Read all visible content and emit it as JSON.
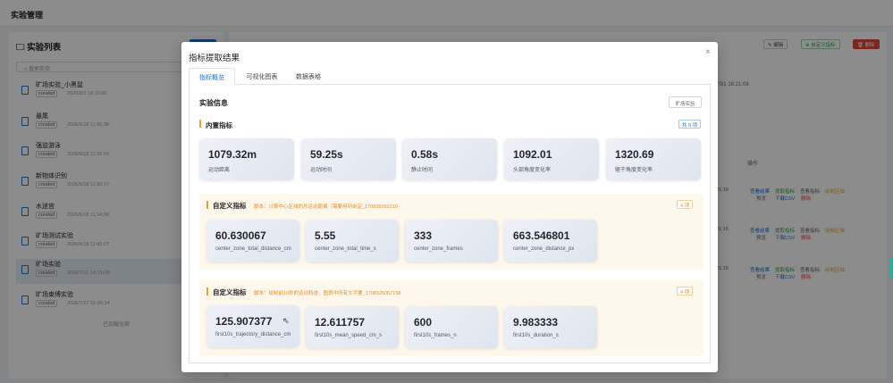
{
  "app": {
    "title": "实验管理",
    "left": {
      "title": "实验列表",
      "search_placeholder": "搜索实验",
      "items": [
        {
          "name": "旷场实验_小黑鼠",
          "status": "created",
          "time": "2026/6/3 18:19:00"
        },
        {
          "name": "悬尾",
          "status": "created",
          "time": "2026/6/18 11:56:38"
        },
        {
          "name": "强迫游泳",
          "status": "created",
          "time": "2026/6/18 11:56:04"
        },
        {
          "name": "新物体识别",
          "status": "created",
          "time": "2026/6/18 11:55:17"
        },
        {
          "name": "水迷宫",
          "status": "created",
          "time": "2026/6/18 11:54:36"
        },
        {
          "name": "旷场测试实验",
          "status": "created",
          "time": "2026/6/18 11:42:07"
        },
        {
          "name": "旷场实验",
          "status": "created",
          "time": "2026/7/31 16:21:08"
        },
        {
          "name": "旷场束缚实验",
          "status": "created",
          "time": "2026/7/27 15:05:34"
        }
      ],
      "footer": "已加载全部"
    },
    "right": {
      "edit": "编辑",
      "custom_metric": "自定义指标",
      "delete": "删除",
      "time": "7/31 16:21:08",
      "ops_header": "操作",
      "row_time": "21:15",
      "ops": {
        "view_result": "查看结果",
        "extract": "提取指标",
        "view_metric": "查看指标",
        "draw_zone": "绘制区域",
        "preview": "预览",
        "download": "下载CSV",
        "del": "删除"
      }
    }
  },
  "modal": {
    "title": "指标提取结果",
    "close": "×",
    "tabs": [
      "指标概览",
      "可视化图表",
      "数据表格"
    ],
    "section_title": "实验信息",
    "section_button": "旷场实验",
    "builtin": {
      "title": "内置指标",
      "count": "共 5 项",
      "cards": [
        {
          "value": "1079.32m",
          "label": "运动距离"
        },
        {
          "value": "59.25s",
          "label": "运动时间"
        },
        {
          "value": "0.58s",
          "label": "静止时间"
        },
        {
          "value": "1092.01",
          "label": "头部角度变化率"
        },
        {
          "value": "1320.69",
          "label": "躯干角度变化率"
        }
      ]
    },
    "custom": [
      {
        "title": "自定义指标",
        "script": "脚本：计算中心区域的总运动距离（需要用到自定_170835059310",
        "count": "4 项",
        "cards": [
          {
            "value": "60.630067",
            "label": "center_zone_total_distance_cm"
          },
          {
            "value": "5.55",
            "label": "center_zone_total_time_s"
          },
          {
            "value": "333",
            "label": "center_zone_frames"
          },
          {
            "value": "663.546801",
            "label": "center_zone_distance_px"
          }
        ]
      },
      {
        "title": "自定义指标",
        "script": "脚本：绘制前10秒的运动轨迹，图表中所有文字要_1708925057158",
        "count": "4 项",
        "cards": [
          {
            "value": "125.907377",
            "label": "first10s_trajectory_distance_cm"
          },
          {
            "value": "12.611757",
            "label": "first10s_mean_speed_cm_s"
          },
          {
            "value": "600",
            "label": "first10s_frames_n"
          },
          {
            "value": "9.983333",
            "label": "first10s_duration_s"
          }
        ]
      }
    ]
  },
  "colors": {
    "accent": "#1e70cf",
    "warning": "#e5a23c",
    "success": "#2fa34f",
    "danger": "#e0453b"
  }
}
